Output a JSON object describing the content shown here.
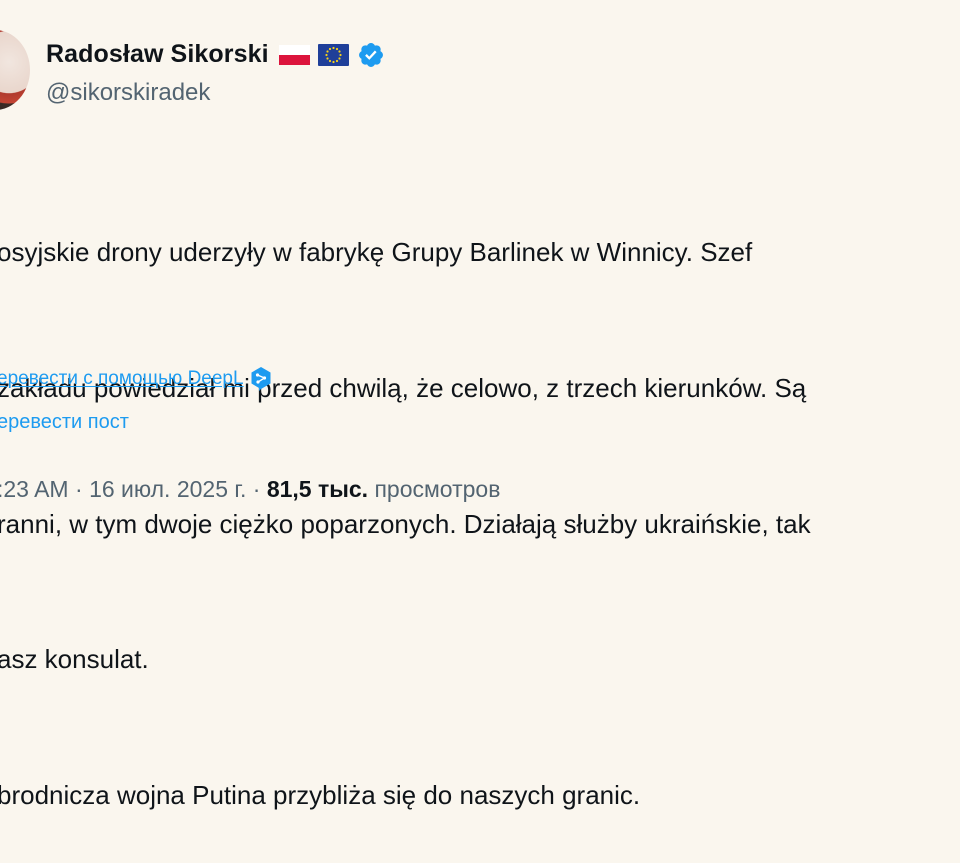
{
  "author": {
    "name": "Radosław Sikorski",
    "handle": "@sikorskiradek"
  },
  "tweet": {
    "lines": [
      "osyjskie drony uderzyły w fabrykę Grupy Barlinek w Winnicy. Szef",
      "zakładu powiedział mi przed chwilą, że celowo, z trzech kierunków. Są",
      "ranni, w tym dwoje ciężko poparzonych. Działają służby ukraińskie, tak",
      "asz konsulat.",
      "brodnicza wojna Putina przybliża się do naszych granic."
    ]
  },
  "translate": {
    "deepl_label": "еревести с помощью DeepL",
    "post_label": "еревести пост"
  },
  "meta": {
    "time": ":23 AM",
    "separator1": " · ",
    "date": "16 июл. 2025 г.",
    "separator2": " · ",
    "views_count": "81,5 тыс.",
    "views_label": " просмотров"
  },
  "colors": {
    "background": "#faf6ee",
    "link": "#1d9bf0",
    "secondary": "#536471",
    "verified": "#1d9bf0"
  },
  "icons": [
    "avatar",
    "poland-flag-icon",
    "eu-flag-icon",
    "verified-badge-icon",
    "deepl-icon"
  ]
}
